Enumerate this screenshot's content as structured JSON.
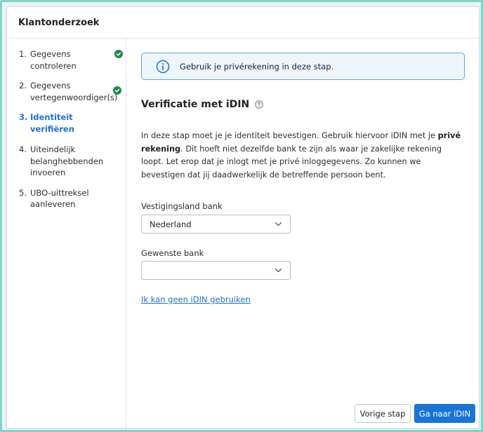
{
  "dialog": {
    "title": "Klantonderzoek"
  },
  "steps": [
    {
      "num": "1.",
      "label": "Gegevens controleren",
      "completed": true
    },
    {
      "num": "2.",
      "label": "Gegevens vertegenwoordiger(s)",
      "completed": true
    },
    {
      "num": "3.",
      "label": "Identiteit verifiëren",
      "active": true
    },
    {
      "num": "4.",
      "label": "Uiteindelijk belanghebbenden invoeren"
    },
    {
      "num": "5.",
      "label": "UBO-uittreksel aanleveren"
    }
  ],
  "info": {
    "text": "Gebruik je privérekening in deze stap.",
    "icon": "info-icon"
  },
  "section": {
    "title": "Verificatie met iDIN"
  },
  "description": {
    "part1": "In deze stap moet je je identiteit bevestigen. Gebruik hiervoor iDIN met je ",
    "bold": "privé rekening",
    "part2": ". Dit hoeft niet dezelfde bank te zijn als waar je zakelijke rekening loopt. Let erop dat je inlogt met je privé inloggegevens. Zo kunnen we bevestigen dat jij daadwerkelijk de betreffende persoon bent."
  },
  "country_field": {
    "label": "Vestigingsland bank",
    "value": "Nederland"
  },
  "bank_field": {
    "label": "Gewenste bank",
    "value": ""
  },
  "no_idin_link": "Ik kan geen iDIN gebruiken",
  "buttons": {
    "previous": "Vorige stap",
    "next": "Ga naar iDIN"
  },
  "colors": {
    "accent": "#1874d6",
    "success": "#1f8a4c",
    "info_border": "#5aa6e6",
    "info_bg": "#eef6fd"
  }
}
